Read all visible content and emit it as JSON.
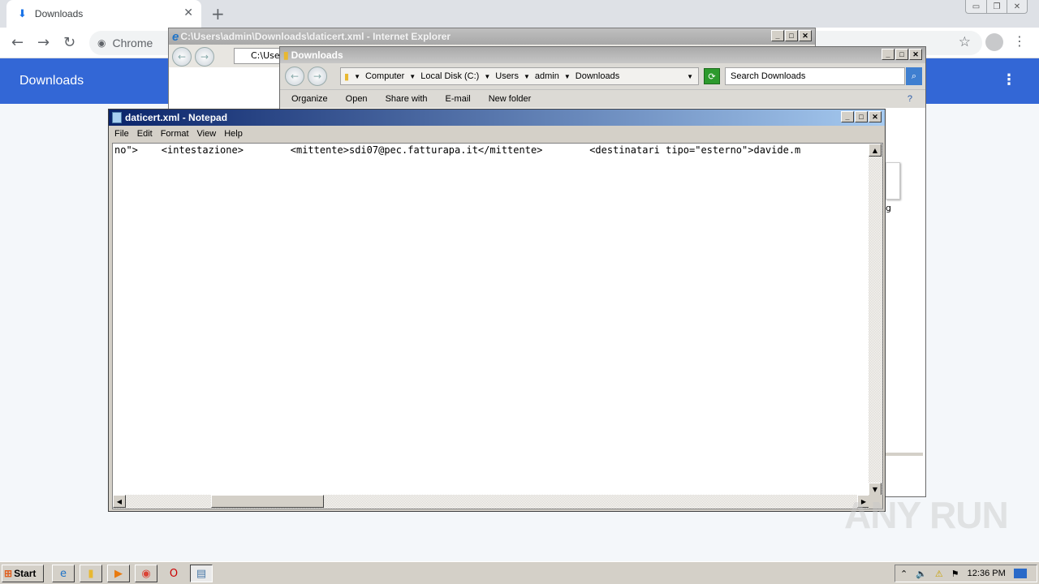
{
  "chrome": {
    "tab_label": "Downloads",
    "omnibox_chip": "Chrome",
    "page_title": "Downloads",
    "accent": "#3367d6"
  },
  "ie": {
    "title": "C:\\Users\\admin\\Downloads\\daticert.xml - Internet Explorer",
    "address": "C:\\Use"
  },
  "explorer": {
    "title": "Downloads",
    "breadcrumb": [
      "Computer",
      "Local Disk (C:)",
      "Users",
      "admin",
      "Downloads"
    ],
    "search_placeholder": "Search Downloads",
    "commands": [
      "Organize",
      "Open",
      "Share with",
      "E-mail",
      "New folder"
    ],
    "partial_item_label": "g"
  },
  "notepad": {
    "title": "daticert.xml - Notepad",
    "menu": [
      "File",
      "Edit",
      "Format",
      "View",
      "Help"
    ],
    "content": "no\">    <intestazione>        <mittente>sdi07@pec.fatturapa.it</mittente>        <destinatari tipo=\"esterno\">davide.m"
  },
  "watermark": "ANY RUN",
  "taskbar": {
    "start_label": "Start",
    "clock": "12:36 PM"
  }
}
